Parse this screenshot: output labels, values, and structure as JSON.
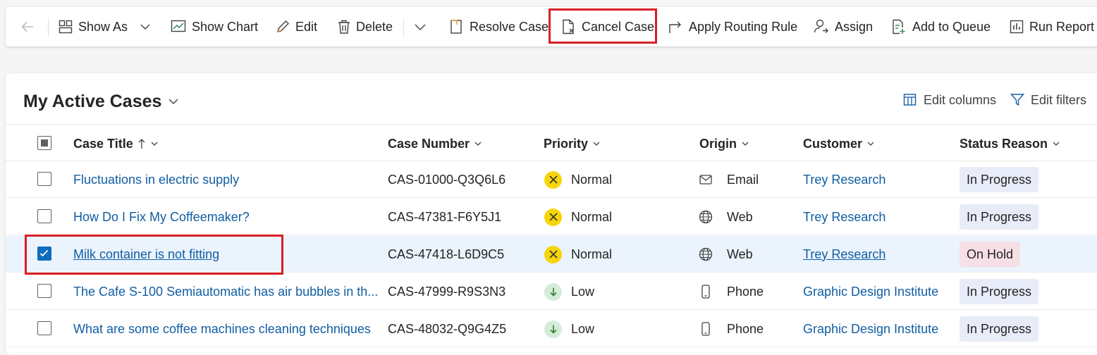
{
  "toolbar": {
    "show_as": "Show As",
    "show_chart": "Show Chart",
    "edit": "Edit",
    "delete": "Delete",
    "resolve_case": "Resolve Case",
    "cancel_case": "Cancel Case",
    "apply_routing_rule": "Apply Routing Rule",
    "assign": "Assign",
    "add_to_queue": "Add to Queue",
    "run_report": "Run Report"
  },
  "view": {
    "title": "My Active Cases",
    "edit_columns": "Edit columns",
    "edit_filters": "Edit filters"
  },
  "columns": {
    "case_title": "Case Title",
    "case_number": "Case Number",
    "priority": "Priority",
    "origin": "Origin",
    "customer": "Customer",
    "status_reason": "Status Reason"
  },
  "rows": [
    {
      "title": "Fluctuations in electric supply",
      "number": "CAS-01000-Q3Q6L6",
      "priority": "Normal",
      "priority_icon": "normal-priority-icon",
      "origin": "Email",
      "origin_icon": "mail-icon",
      "customer": "Trey Research",
      "status": "In Progress",
      "checked": false
    },
    {
      "title": "How Do I Fix My Coffeemaker?",
      "number": "CAS-47381-F6Y5J1",
      "priority": "Normal",
      "priority_icon": "normal-priority-icon",
      "origin": "Web",
      "origin_icon": "globe-icon",
      "customer": "Trey Research",
      "status": "In Progress",
      "checked": false
    },
    {
      "title": "Milk container is not fitting",
      "number": "CAS-47418-L6D9C5",
      "priority": "Normal",
      "priority_icon": "normal-priority-icon",
      "origin": "Web",
      "origin_icon": "globe-icon",
      "customer": "Trey Research",
      "status": "On Hold",
      "checked": true
    },
    {
      "title": "The Cafe S-100 Semiautomatic has air bubbles in th...",
      "number": "CAS-47999-R9S3N3",
      "priority": "Low",
      "priority_icon": "low-priority-icon",
      "origin": "Phone",
      "origin_icon": "phone-icon",
      "customer": "Graphic Design Institute",
      "status": "In Progress",
      "checked": false
    },
    {
      "title": "What are some coffee machines cleaning techniques",
      "number": "CAS-48032-Q9G4Z5",
      "priority": "Low",
      "priority_icon": "low-priority-icon",
      "origin": "Phone",
      "origin_icon": "phone-icon",
      "customer": "Graphic Design Institute",
      "status": "In Progress",
      "checked": false
    }
  ],
  "colors": {
    "highlight": "#d81f26",
    "link": "#115ea3",
    "selected_row": "#ebf3fc",
    "in_progress_badge": "#e8ecf8",
    "on_hold_badge": "#f7dfe6",
    "normal_priority": "#f7d50a",
    "low_priority": "#d5ecd8"
  }
}
